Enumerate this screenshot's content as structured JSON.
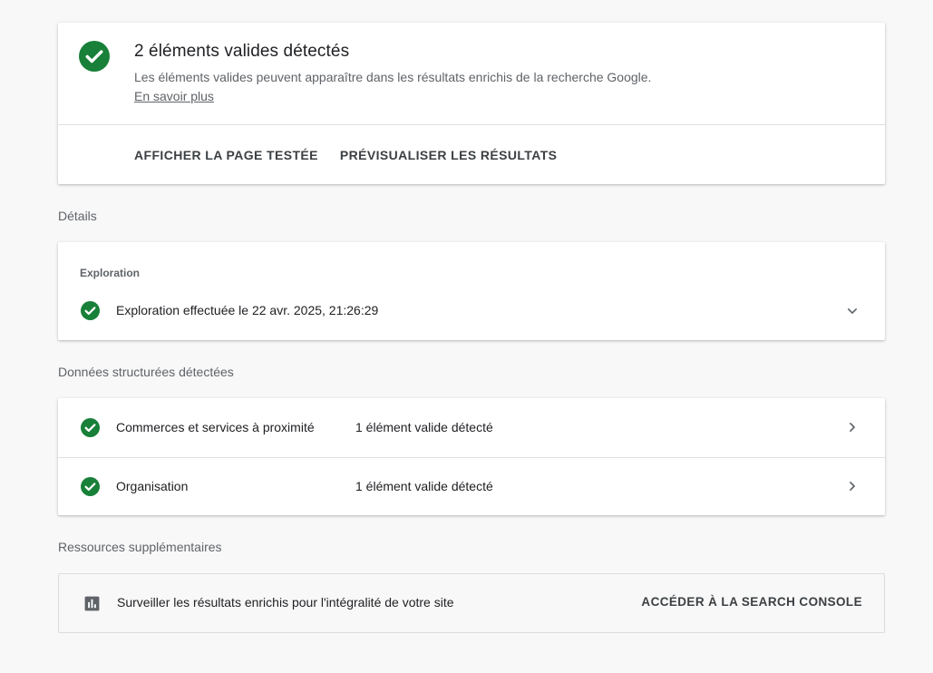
{
  "summary": {
    "title": "2 éléments valides détectés",
    "description": "Les éléments valides peuvent apparaître dans les résultats enrichis de la recherche Google.",
    "learn_more": "En savoir plus",
    "actions": [
      "AFFICHER LA PAGE TESTÉE",
      "PRÉVISUALISER LES RÉSULTATS"
    ]
  },
  "sections": {
    "details": "Détails",
    "structured_data": "Données structurées détectées",
    "resources": "Ressources supplémentaires"
  },
  "exploration": {
    "label": "Exploration",
    "status": "Exploration effectuée le 22 avr. 2025, 21:26:29"
  },
  "structured_items": [
    {
      "name": "Commerces et services à proximité",
      "status": "1 élément valide détecté"
    },
    {
      "name": "Organisation",
      "status": "1 élément valide détecté"
    }
  ],
  "resources": {
    "text": "Surveiller les résultats enrichis pour l'intégralité de votre site",
    "link": "ACCÉDER À LA SEARCH CONSOLE"
  },
  "colors": {
    "success": "#188038",
    "background": "#f8f8f8",
    "card": "#ffffff"
  },
  "icons": [
    "check-circle-icon",
    "chevron-down-icon",
    "chevron-right-icon",
    "bar-chart-icon"
  ]
}
